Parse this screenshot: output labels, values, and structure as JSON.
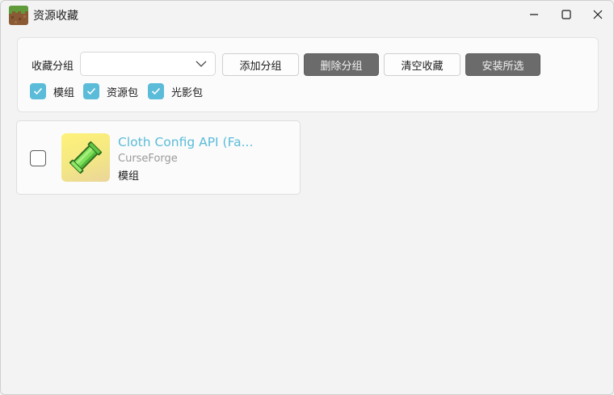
{
  "window": {
    "title": "资源收藏",
    "app_icon": "grass-block-icon"
  },
  "toolbar": {
    "group_label": "收藏分组",
    "group_select_value": "",
    "add_group_label": "添加分组",
    "delete_group_label": "删除分组",
    "clear_favorites_label": "清空收藏",
    "install_selected_label": "安装所选"
  },
  "filters": [
    {
      "label": "模组",
      "checked": true
    },
    {
      "label": "资源包",
      "checked": true
    },
    {
      "label": "光影包",
      "checked": true
    }
  ],
  "items": [
    {
      "title": "Cloth Config API (Fa...",
      "source": "CurseForge",
      "type": "模组",
      "checked": false,
      "icon": "cloth-scroll-icon"
    }
  ],
  "colors": {
    "accent": "#5bbcd9",
    "disabled_button": "#6b6b6b",
    "background": "#f3f3f3"
  }
}
